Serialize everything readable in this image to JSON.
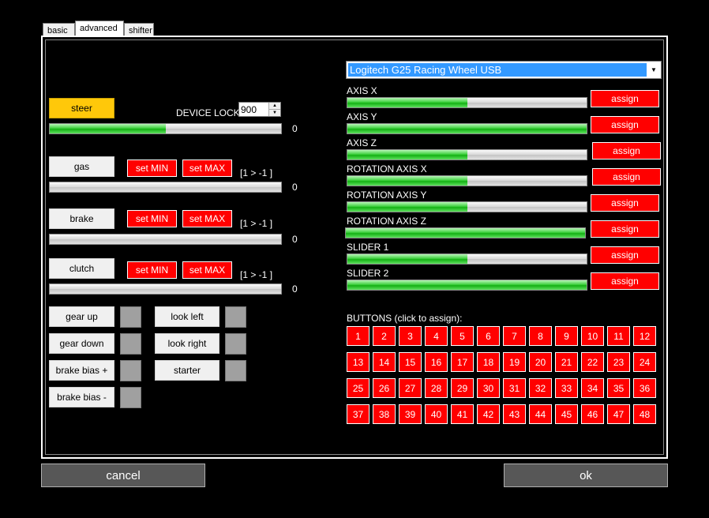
{
  "tabs": [
    {
      "label": "basic",
      "active": false
    },
    {
      "label": "advanced",
      "active": true
    },
    {
      "label": "shifter",
      "active": false
    }
  ],
  "device": {
    "selected": "Logitech G25 Racing Wheel USB"
  },
  "left": {
    "steer": {
      "label": "steer",
      "value": "0",
      "fill": 0.5
    },
    "device_lock": {
      "label": "DEVICE LOCK",
      "value": "900"
    },
    "pedals": [
      {
        "label": "gas",
        "set_min": "set MIN",
        "set_max": "set MAX",
        "range": "[1 > -1 ]",
        "value": "0",
        "fill": 0
      },
      {
        "label": "brake",
        "set_min": "set MIN",
        "set_max": "set MAX",
        "range": "[1 > -1 ]",
        "value": "0",
        "fill": 0
      },
      {
        "label": "clutch",
        "set_min": "set MIN",
        "set_max": "set MAX",
        "range": "[1 > -1 ]",
        "value": "0",
        "fill": 0
      }
    ],
    "controls": {
      "gear_up": "gear up",
      "gear_down": "gear down",
      "brake_bias_plus": "brake bias +",
      "brake_bias_minus": "brake bias -",
      "look_left": "look left",
      "look_right": "look right",
      "starter": "starter"
    }
  },
  "axes": [
    {
      "label": "AXIS X",
      "fill": 0.5,
      "assign": "assign"
    },
    {
      "label": "AXIS Y",
      "fill": 1.0,
      "assign": "assign"
    },
    {
      "label": "AXIS Z",
      "fill": 0.5,
      "assign": "assign"
    },
    {
      "label": "ROTATION AXIS X",
      "fill": 0.5,
      "assign": "assign"
    },
    {
      "label": "ROTATION AXIS Y",
      "fill": 0.5,
      "assign": "assign"
    },
    {
      "label": "ROTATION AXIS Z",
      "fill": 1.0,
      "assign": "assign"
    },
    {
      "label": "SLIDER 1",
      "fill": 0.5,
      "assign": "assign"
    },
    {
      "label": "SLIDER 2",
      "fill": 1.0,
      "assign": "assign"
    }
  ],
  "buttons_title": "BUTTONS (click to assign):",
  "buttons": [
    "1",
    "2",
    "3",
    "4",
    "5",
    "6",
    "7",
    "8",
    "9",
    "10",
    "11",
    "12",
    "13",
    "14",
    "15",
    "16",
    "17",
    "18",
    "19",
    "20",
    "21",
    "22",
    "23",
    "24",
    "25",
    "26",
    "27",
    "28",
    "29",
    "30",
    "31",
    "32",
    "33",
    "34",
    "35",
    "36",
    "37",
    "38",
    "39",
    "40",
    "41",
    "42",
    "43",
    "44",
    "45",
    "46",
    "47",
    "48"
  ],
  "footer": {
    "cancel": "cancel",
    "ok": "ok"
  }
}
